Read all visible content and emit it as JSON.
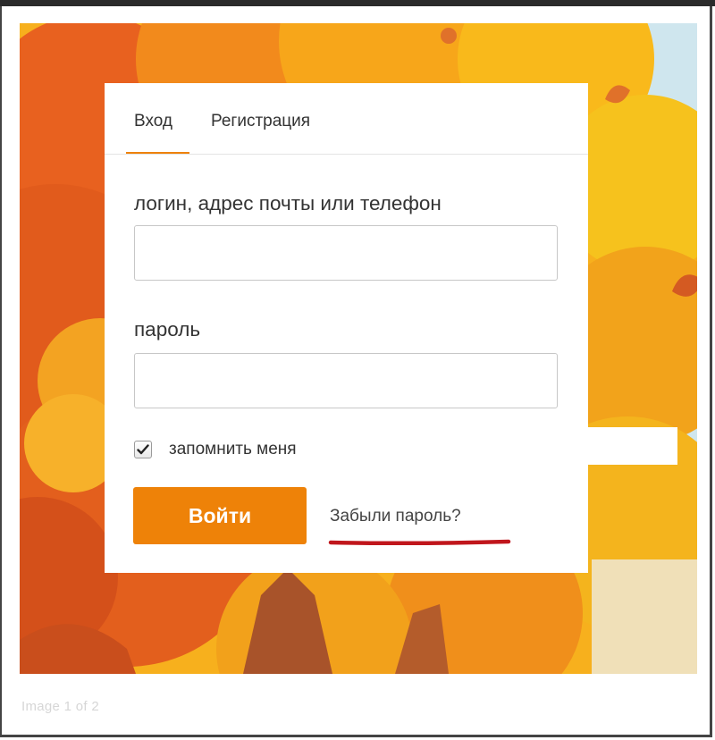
{
  "tabs": [
    {
      "label": "Вход",
      "active": true
    },
    {
      "label": "Регистрация",
      "active": false
    }
  ],
  "form": {
    "login_label": "логин, адрес почты или телефон",
    "login_value": "",
    "password_label": "пароль",
    "password_value": "",
    "remember_label": "запомнить меня",
    "remember_checked": true,
    "submit_label": "Войти",
    "forgot_label": "Забыли пароль?"
  },
  "caption": "Image 1 of 2",
  "colors": {
    "accent": "#ee8208",
    "annotation_underline": "#c0161c",
    "text": "#333333"
  },
  "icons": {
    "checkbox": "checkmark-icon"
  }
}
